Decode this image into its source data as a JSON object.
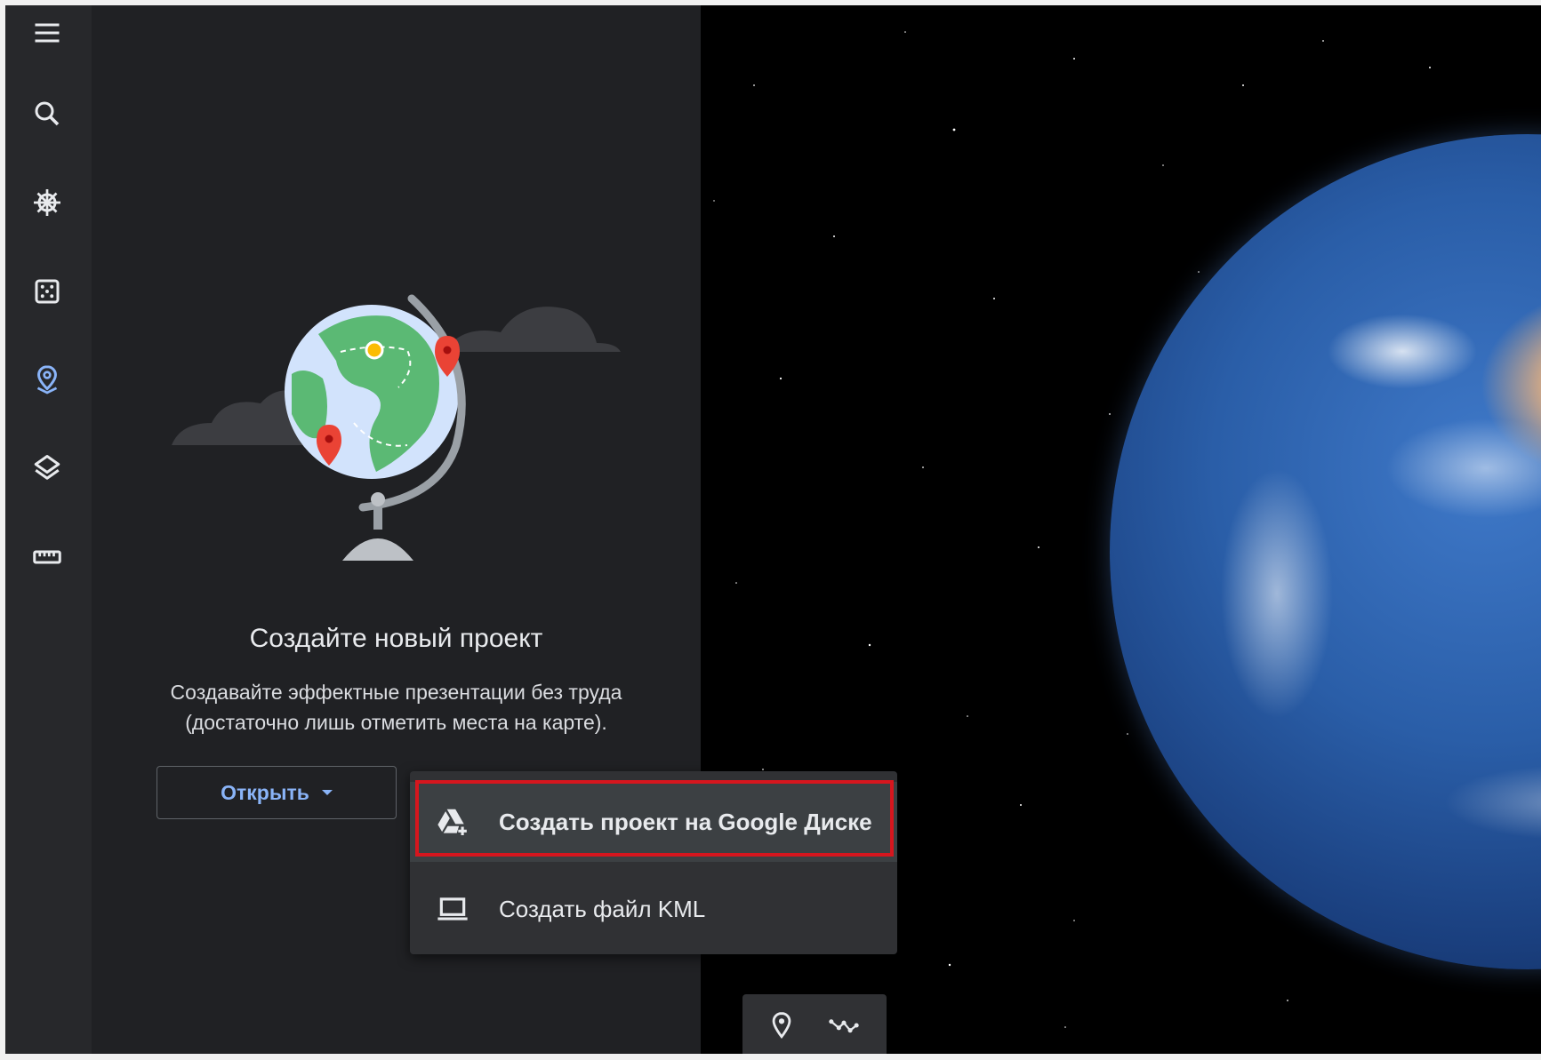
{
  "rail": {
    "items": [
      {
        "name": "menu",
        "icon": "hamburger-menu-icon"
      },
      {
        "name": "search",
        "icon": "search-icon"
      },
      {
        "name": "voyager",
        "icon": "ship-wheel-icon"
      },
      {
        "name": "feeling-lucky",
        "icon": "dice-icon"
      },
      {
        "name": "projects",
        "icon": "location-pin-icon",
        "active": true
      },
      {
        "name": "map-style",
        "icon": "layers-icon"
      },
      {
        "name": "measure",
        "icon": "ruler-icon"
      }
    ],
    "active_color": "#8ab4f8"
  },
  "panel": {
    "title": "Создайте новый проект",
    "description_line1": "Создавайте эффектные презентации без труда",
    "description_line2": "(достаточно лишь отметить места на карте).",
    "open_button": "Открыть"
  },
  "menu": {
    "items": [
      {
        "label": "Создать проект на Google Диске",
        "icon": "google-drive-add-icon",
        "highlighted": true
      },
      {
        "label": "Создать файл KML",
        "icon": "laptop-icon"
      }
    ],
    "highlight_color": "#d6161e"
  },
  "tools": {
    "items": [
      {
        "icon": "add-placemark-icon"
      },
      {
        "icon": "draw-line-icon"
      }
    ]
  }
}
